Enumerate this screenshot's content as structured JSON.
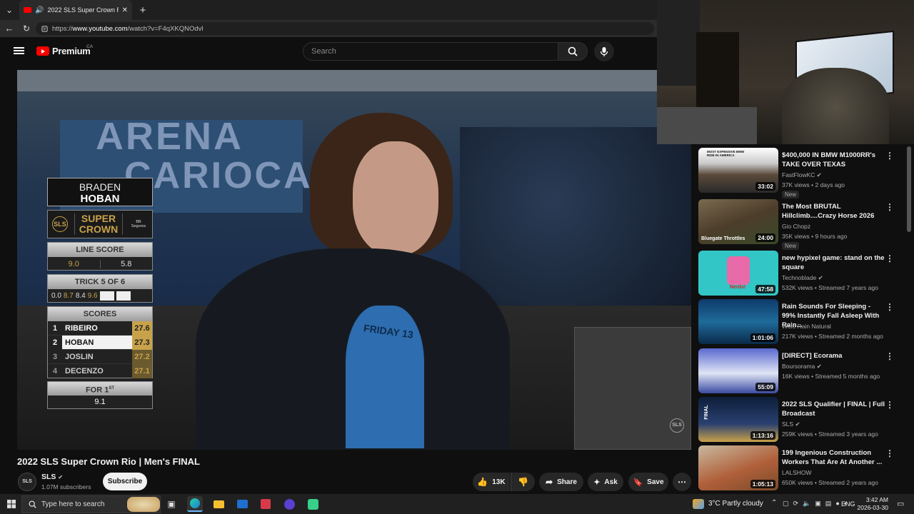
{
  "browser": {
    "tab_title": "2022 SLS Super Crown Rio | M",
    "url_prefix": "https://",
    "url_domain": "www.youtube.com",
    "url_path": "/watch?v=F4qXKQNOdvl"
  },
  "header": {
    "logo_text": "Premium",
    "region": "CA",
    "search_placeholder": "Search"
  },
  "video": {
    "backdrop_text_1": "ARENA",
    "backdrop_text_2": "CARIOCA",
    "shirt_text": "FRIDAY 13",
    "watermark": "SLS"
  },
  "scoreboard": {
    "first_name": "BRADEN",
    "last_name": "HOBAN",
    "logo_sls": "SLS",
    "event_super": "SUPER",
    "event_crown": "CROWN",
    "sponsor": "BB Seguros",
    "line_score_label": "LINE SCORE",
    "line_score_1": "9.0",
    "line_score_2": "5.8",
    "trick_label": "TRICK 5 OF 6",
    "tricks": [
      "0.0",
      "8.7",
      "8.4",
      "9.6"
    ],
    "scores_label": "SCORES",
    "rows": [
      {
        "rank": "1",
        "name": "RIBEIRO",
        "score": "27.6"
      },
      {
        "rank": "2",
        "name": "HOBAN",
        "score": "27.3"
      },
      {
        "rank": "3",
        "name": "JOSLIN",
        "score": "27.2"
      },
      {
        "rank": "4",
        "name": "DECENZO",
        "score": "27.1"
      }
    ],
    "for_label": "FOR 1",
    "for_sup": "ST",
    "for_value": "9.1"
  },
  "below": {
    "title": "2022 SLS Super Crown Rio | Men's FINAL",
    "channel": "SLS",
    "subscribers": "1.07M subscribers",
    "subscribe": "Subscribe",
    "likes": "13K",
    "share": "Share",
    "ask": "Ask",
    "save": "Save"
  },
  "sidebar": [
    {
      "title": "$400,000 IN BMW M1000RR's TAKE OVER TEXAS",
      "channel": "FastFlowKC",
      "meta": "37K views • 2 days ago",
      "badge": "New",
      "duration": "33:02",
      "thumb_text": "MOST EXPENSIVE BMW RIDE IN AMERICA"
    },
    {
      "title": "The Most BRUTAL Hillclimb....Crazy Horse 2026",
      "channel": "Gio Chopz",
      "meta": "35K views • 9 hours ago",
      "badge": "New",
      "duration": "24:00",
      "thumb_text": "Bluegate Throttles"
    },
    {
      "title": "new hypixel game: stand on the square",
      "channel": "Technoblade",
      "meta": "532K views • Streamed 7 years ago",
      "badge": "",
      "duration": "47:58",
      "thumb_text": "Nerds!"
    },
    {
      "title": "Rain Sounds For Sleeping - 99% Instantly Fall Asleep With Rain...",
      "channel": "Welo Rain Natural",
      "meta": "217K views • Streamed 2 months ago",
      "badge": "",
      "duration": "1:01:06",
      "thumb_text": ""
    },
    {
      "title": "[DIRECT] Ecorama",
      "channel": "Boursorama",
      "meta": "16K views • Streamed 5 months ago",
      "badge": "",
      "duration": "55:09",
      "thumb_text": ""
    },
    {
      "title": "2022 SLS Qualifier | FINAL | Full Broadcast",
      "channel": "SLS",
      "meta": "259K views • Streamed 3 years ago",
      "badge": "",
      "duration": "1:13:16",
      "thumb_text": "FINAL"
    },
    {
      "title": "199 Ingenious Construction Workers That Are At Another ...",
      "channel": "LALSHOW",
      "meta": "650K views • Streamed 2 years ago",
      "badge": "",
      "duration": "1:05:13",
      "thumb_text": ""
    }
  ],
  "taskbar": {
    "search_placeholder": "Type here to search",
    "weather": "3°C  Partly cloudy",
    "lang": "ENG",
    "time": "3:42 AM",
    "date": "2026-03-30"
  },
  "colors": {
    "youtube_red": "#ff0000",
    "accent_gold": "#c8a24a"
  }
}
